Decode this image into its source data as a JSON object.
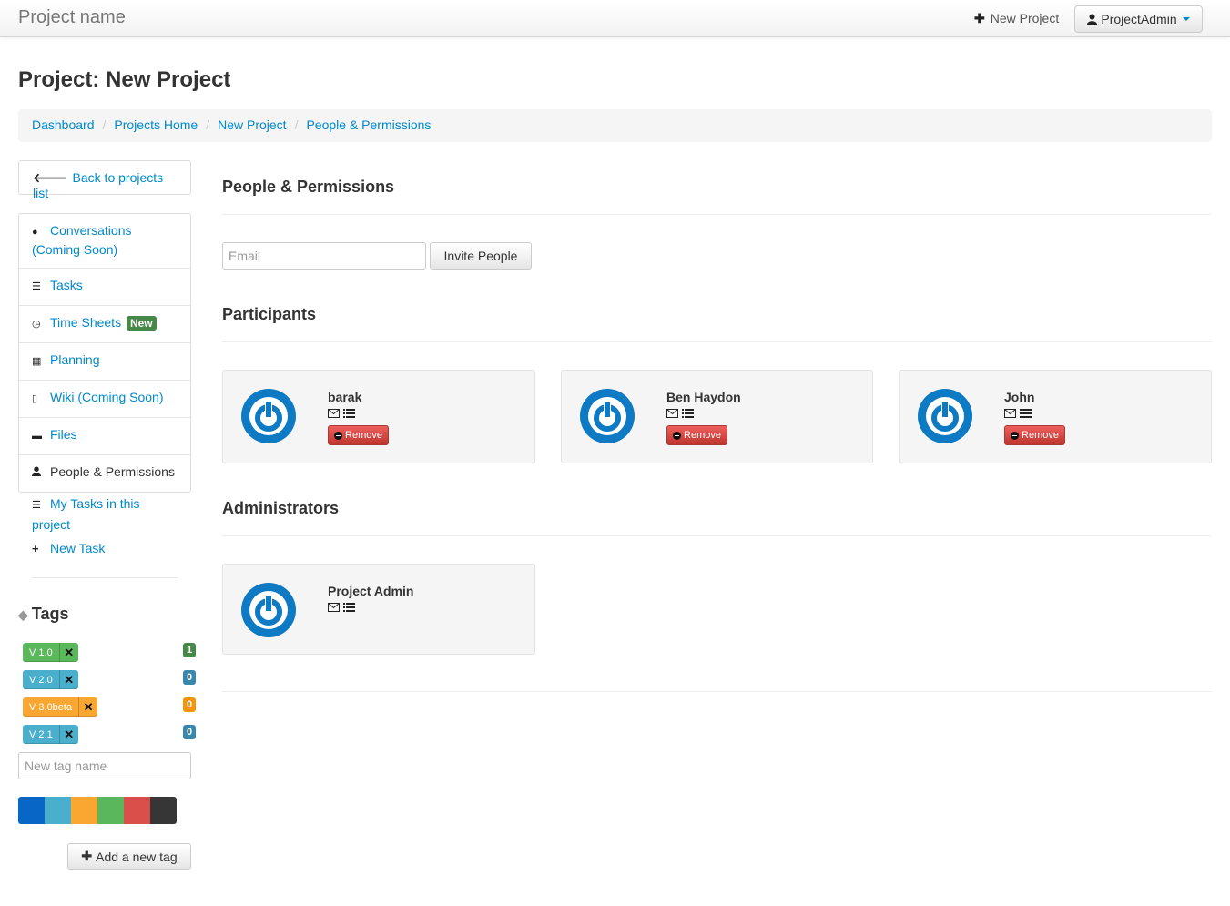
{
  "navbar": {
    "brand": "Project name",
    "new_project": "New Project",
    "user": "ProjectAdmin"
  },
  "page": {
    "title": "Project: New Project"
  },
  "breadcrumb": [
    "Dashboard",
    "Projects Home",
    "New Project",
    "People & Permissions"
  ],
  "sidebar": {
    "back": "Back to projects list",
    "items": [
      {
        "label": "Conversations (Coming Soon)",
        "icon": "comment-icon"
      },
      {
        "label": "Tasks",
        "icon": "tasks-icon"
      },
      {
        "label": "Time Sheets",
        "icon": "clock-icon",
        "badge": "New"
      },
      {
        "label": "Planning",
        "icon": "calendar-icon"
      },
      {
        "label": "Wiki (Coming Soon)",
        "icon": "file-icon"
      },
      {
        "label": "Files",
        "icon": "folder-icon"
      },
      {
        "label": "People & Permissions",
        "icon": "user-icon"
      }
    ],
    "quick_links": {
      "my_tasks": "My Tasks in this project",
      "new_task": "New Task"
    }
  },
  "tags": {
    "title": "Tags",
    "list": [
      {
        "name": "V 1.0",
        "count": "1",
        "color": "#5bb75b",
        "count_color": "#468847"
      },
      {
        "name": "V 2.0",
        "count": "0",
        "color": "#49afcd",
        "count_color": "#3a87ad"
      },
      {
        "name": "V 3.0beta",
        "count": "0",
        "color": "#faa732",
        "count_color": "#f89406"
      },
      {
        "name": "V 2.1",
        "count": "0",
        "color": "#49afcd",
        "count_color": "#3a87ad"
      }
    ],
    "new_tag_placeholder": "New tag name",
    "swatch_colors": [
      "#0866c6",
      "#49afcd",
      "#faa732",
      "#5bb75b",
      "#da4f49",
      "#363636"
    ],
    "add_button": "Add a new tag"
  },
  "main": {
    "section_title": "People & Permissions",
    "email_placeholder": "Email",
    "invite_button": "Invite People",
    "participants_title": "Participants",
    "participants": [
      {
        "name": "barak",
        "remove": "Remove"
      },
      {
        "name": "Ben Haydon",
        "remove": "Remove"
      },
      {
        "name": "John",
        "remove": "Remove"
      }
    ],
    "administrators_title": "Administrators",
    "administrators": [
      {
        "name": "Project Admin"
      }
    ]
  },
  "colors": {
    "link": "#0088cc",
    "avatar": "#0e7ac4",
    "danger": "#da4f49"
  }
}
